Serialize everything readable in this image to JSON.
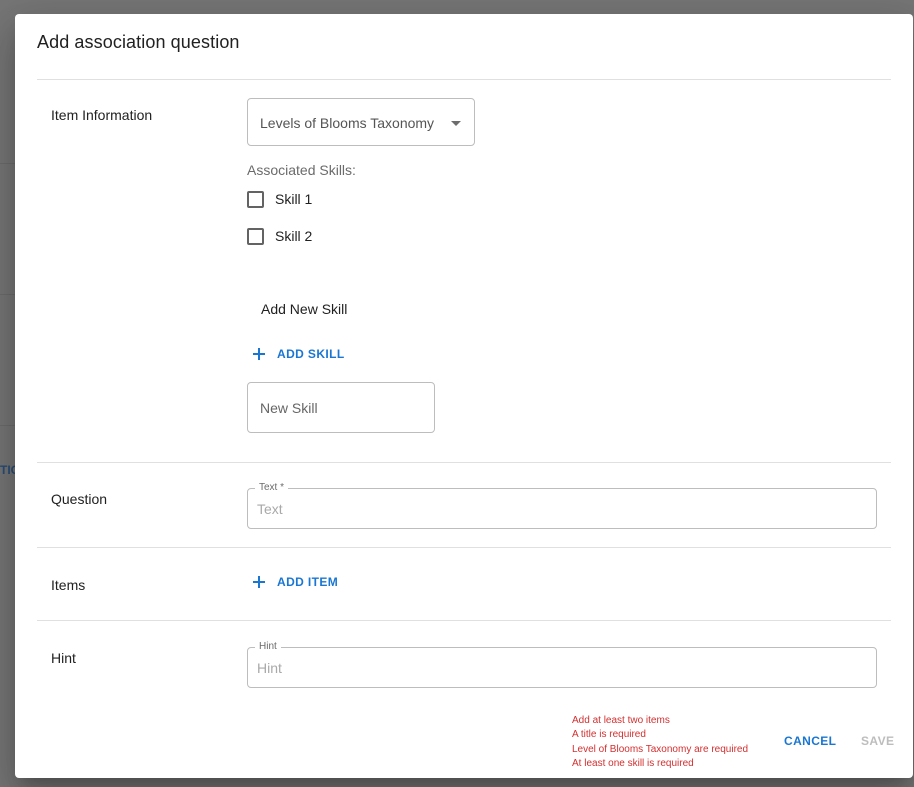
{
  "background": {
    "partial_text": "TIO"
  },
  "dialog": {
    "title": "Add association question",
    "item_information": {
      "label": "Item Information",
      "select_value": "Levels of Blooms Taxonomy",
      "associated_skills_label": "Associated Skills:",
      "skills": [
        {
          "label": "Skill 1",
          "checked": false
        },
        {
          "label": "Skill 2",
          "checked": false
        }
      ],
      "add_new_skill_label": "Add New Skill",
      "add_skill_button": "ADD SKILL",
      "new_skill_placeholder": "New Skill"
    },
    "question": {
      "label": "Question",
      "text_legend": "Text *",
      "text_placeholder": "Text"
    },
    "items": {
      "label": "Items",
      "add_item_button": "ADD ITEM"
    },
    "hint": {
      "label": "Hint",
      "hint_legend": "Hint",
      "hint_placeholder": "Hint"
    },
    "errors": [
      "Add at least two items",
      "A title is required",
      "Level of Blooms Taxonomy are required",
      "At least one skill is required"
    ],
    "actions": {
      "cancel": "CANCEL",
      "save": "SAVE"
    }
  },
  "colors": {
    "accent": "#1976d2",
    "error": "#d32f2f",
    "disabled": "#bdbdbd"
  }
}
